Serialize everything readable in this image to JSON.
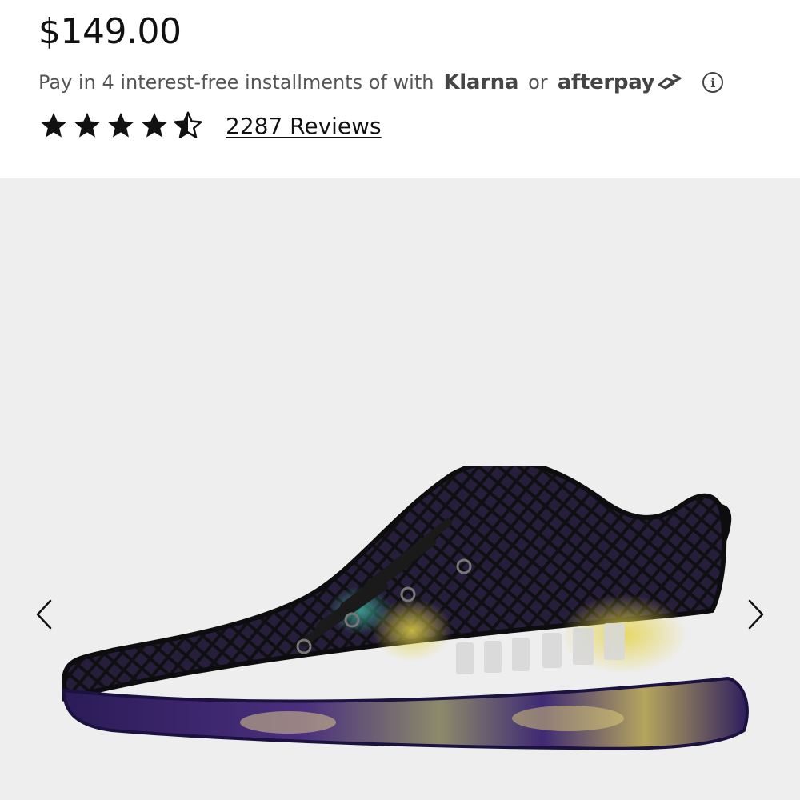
{
  "product": {
    "price": "$149.00",
    "installments": {
      "text": "Pay in 4 interest-free installments of with",
      "provider_1": "Klarna",
      "connector": "or",
      "provider_2": "afterpay",
      "info_icon": "info-circle-icon"
    },
    "rating": {
      "stars_value": 4.5,
      "stars_max": 5,
      "reviews_label": "2287 Reviews"
    }
  },
  "gallery": {
    "prev_icon": "chevron-left-icon",
    "next_icon": "chevron-right-icon",
    "background_color": "#eeeeef",
    "image": "sneaker-product-image"
  }
}
